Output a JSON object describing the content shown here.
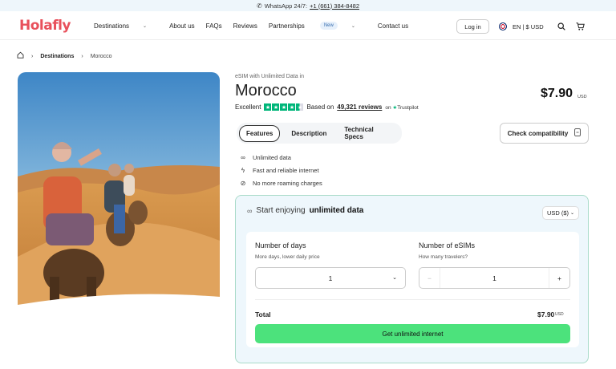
{
  "topbar": {
    "whatsapp_label": "WhatsApp 24/7:",
    "phone": "+1 (661) 384-8482"
  },
  "nav": {
    "logo": "Holafly",
    "items": [
      {
        "label": "Destinations",
        "has_chevron": true
      },
      {
        "label": "About us"
      },
      {
        "label": "FAQs"
      },
      {
        "label": "Reviews"
      },
      {
        "label": "Partnerships",
        "badge": "New",
        "has_chevron": true
      },
      {
        "label": "Contact us"
      }
    ],
    "login": "Log in",
    "language": "EN | $ USD"
  },
  "breadcrumb": {
    "level1": "Destinations",
    "level2": "Morocco"
  },
  "product": {
    "subtitle": "eSIM with Unlimited Data in",
    "title": "Morocco",
    "price": "$7.90",
    "price_unit": "USD",
    "rating_word": "Excellent",
    "based_on": "Based on",
    "reviews": "49,321 reviews",
    "on": "on",
    "trustpilot": "Trustpilot"
  },
  "tabs": [
    "Features",
    "Description",
    "Technical Specs"
  ],
  "compat_button": "Check compatibility",
  "features": [
    {
      "icon": "infinity-icon",
      "text": "Unlimited data"
    },
    {
      "icon": "lightning-icon",
      "text": "Fast and reliable internet"
    },
    {
      "icon": "no-roaming-icon",
      "text": "No more roaming charges"
    }
  ],
  "purchase": {
    "heading_prefix": "Start enjoying",
    "heading_bold": "unlimited data",
    "currency": "USD ($)",
    "days_label": "Number of days",
    "days_sub": "More days, lower daily price",
    "days_value": "1",
    "esims_label": "Number of eSIMs",
    "esims_sub": "How many travelers?",
    "esims_value": "1",
    "total_label": "Total",
    "total_value": "$7.90",
    "total_unit": "USD",
    "cta": "Get unlimited internet"
  },
  "colors": {
    "brand": "#e8505b",
    "cta": "#4ce27c",
    "trustpilot": "#00b67a",
    "card_bg": "#eef7fc"
  }
}
